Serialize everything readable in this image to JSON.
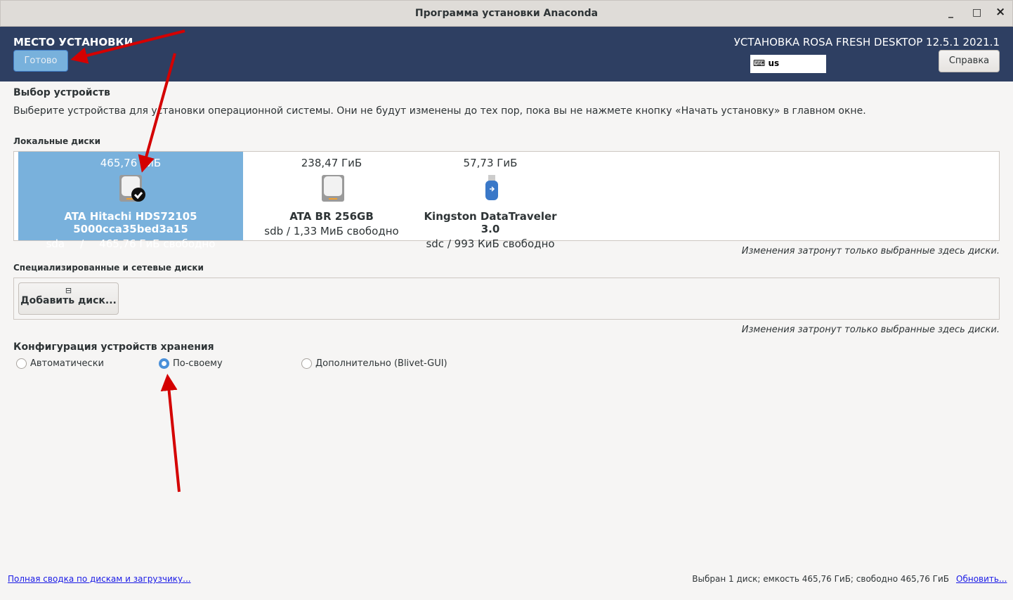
{
  "window": {
    "title": "Программа установки Anaconda",
    "minimize": "_",
    "maximize": "□",
    "close": "×"
  },
  "header": {
    "title": "МЕСТО УСТАНОВКИ",
    "done_label": "Готово",
    "product": "УСТАНОВКА ROSA FRESH DESKTOP 12.5.1 2021.1",
    "keyboard_layout": "us",
    "help_label": "Справка"
  },
  "device_selection": {
    "heading": "Выбор устройств",
    "description": "Выберите устройства для установки операционной системы. Они не будут изменены до тех пор, пока вы не нажмете кнопку «Начать установку» в главном окне."
  },
  "local_disks": {
    "label": "Локальные диски",
    "disks": [
      {
        "size": "465,76 ГиБ",
        "name": "ATA Hitachi HDS72105 5000cca35bed3a15",
        "device": "sda",
        "sep": "/",
        "free": "465,76 ГиБ свободно",
        "selected": true,
        "icon": "hdd-icon"
      },
      {
        "size": "238,47 ГиБ",
        "name": "ATA BR 256GB",
        "device": "sdb",
        "sep": "/",
        "free": "1,33 МиБ свободно",
        "selected": false,
        "icon": "hdd-icon"
      },
      {
        "size": "57,73 ГиБ",
        "name": "Kingston DataTraveler 3.0",
        "device": "sdc",
        "sep": "/",
        "free": "993 КиБ свободно",
        "selected": false,
        "icon": "usb-icon"
      }
    ],
    "note": "Изменения затронут только выбранные здесь диски."
  },
  "network_disks": {
    "label": "Специализированные и сетевые диски",
    "add_label": "Добавить диск...",
    "note": "Изменения затронут только выбранные здесь диски."
  },
  "storage_config": {
    "heading": "Конфигурация устройств хранения",
    "options": [
      {
        "label": "Автоматически",
        "checked": false
      },
      {
        "label": "По-своему",
        "checked": true
      },
      {
        "label": "Дополнительно (Blivet-GUI)",
        "checked": false
      }
    ]
  },
  "footer": {
    "summary_link": "Полная сводка по дискам и загрузчику...",
    "status": "Выбран 1 диск; емкость 465,76 ГиБ; свободно 465,76 ГиБ",
    "refresh_link": "Обновить..."
  },
  "colors": {
    "header_bg": "#2e3f62",
    "selected_disk": "#79b1dc",
    "annotation_arrow": "#d40000"
  }
}
